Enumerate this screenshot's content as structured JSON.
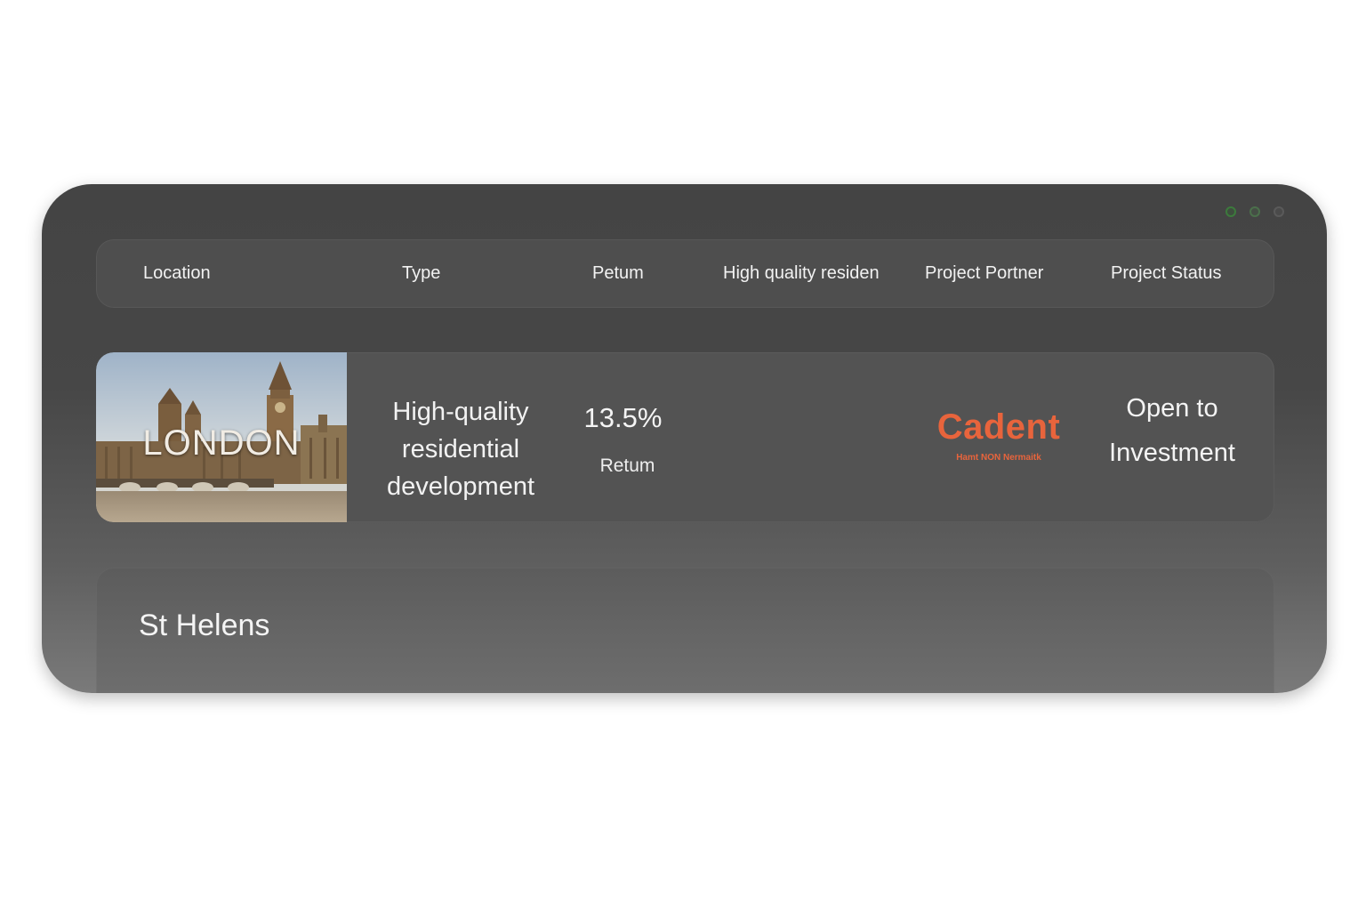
{
  "header": {
    "columns": [
      "Location",
      "Type",
      "Petum",
      "High quality residen",
      "Project Portner",
      "Project Status"
    ]
  },
  "rows": [
    {
      "location": "LONDON",
      "type": "High-quality residential development",
      "return_value": "13.5%",
      "return_label": "Retum",
      "partner_name": "Cadent",
      "partner_tagline": "Hamt NON Nermaitk",
      "status": "Open to Investment"
    },
    {
      "location": "St Helens"
    }
  ],
  "colors": {
    "panel_background": "#444444",
    "partner_brand": "#e8643c",
    "text": "#f2f2f2"
  }
}
